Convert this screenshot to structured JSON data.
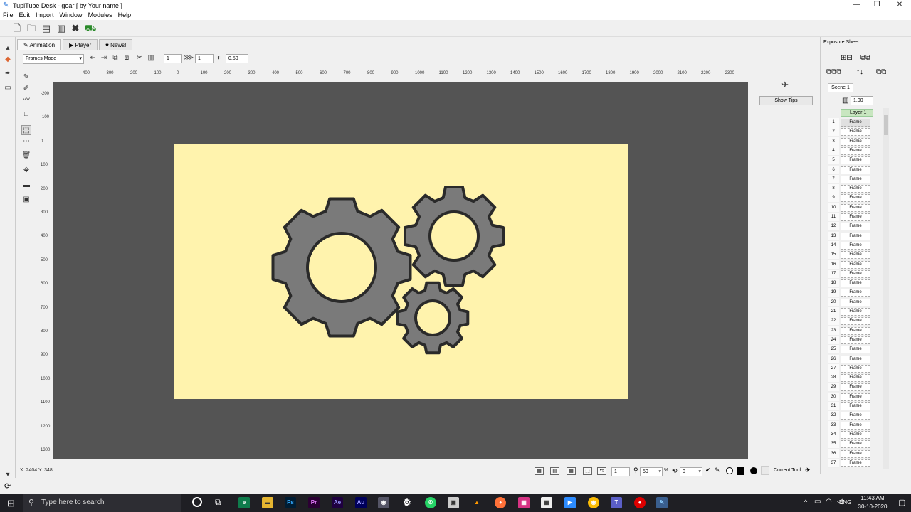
{
  "window": {
    "title": "TupiTube Desk - gear [ by Your name ]",
    "minimize": "—",
    "maximize": "❐",
    "close": "✕"
  },
  "menu": [
    "File",
    "Edit",
    "Import",
    "Window",
    "Modules",
    "Help"
  ],
  "tabs": {
    "animation": "Animation",
    "player": "Player",
    "news": "News!"
  },
  "options": {
    "mode": "Frames Mode",
    "spin1": "1",
    "spin2": "1",
    "opacity": "0.50"
  },
  "ruler": {
    "h_ticks": [
      "-400",
      "-300",
      "-200",
      "-100",
      "0",
      "100",
      "200",
      "300",
      "400",
      "500",
      "600",
      "700",
      "800",
      "900",
      "1000",
      "1100",
      "1200",
      "1300",
      "1400",
      "1500",
      "1600",
      "1700",
      "1800",
      "1900",
      "2000",
      "2100",
      "2200",
      "2300"
    ],
    "v_ticks": [
      "-200",
      "-100",
      "0",
      "100",
      "200",
      "300",
      "400",
      "500",
      "600",
      "700",
      "800",
      "900",
      "1000",
      "1100",
      "1200",
      "1300"
    ]
  },
  "stage": {
    "background": "#fff3ad",
    "gear_fill": "#7a7a7a",
    "gear_stroke": "#2a2a2a"
  },
  "right_panel": {
    "show_tips": "Show Tips"
  },
  "exposure": {
    "title": "Exposure Sheet",
    "scene": "Scene 1",
    "fps": "1.00",
    "layer": "Layer 1",
    "frame_label": "Frame",
    "frame_numbers": [
      "1",
      "2",
      "3",
      "4",
      "5",
      "6",
      "7",
      "8",
      "9",
      "10",
      "11",
      "12",
      "13",
      "14",
      "15",
      "16",
      "17",
      "18",
      "19",
      "20",
      "21",
      "22",
      "23",
      "24",
      "25",
      "26",
      "27",
      "28",
      "29",
      "30",
      "31",
      "32",
      "33",
      "34",
      "35",
      "36",
      "37"
    ]
  },
  "status": {
    "coords": "X: 2404 Y: 348",
    "frame": "1",
    "zoom": "50",
    "zoom_unit": "%",
    "rotation": "0",
    "current_tool": "Current Tool"
  },
  "taskbar": {
    "search_placeholder": "Type here to search",
    "lang": "ENG",
    "time": "11:43 AM",
    "date": "30-10-2020"
  }
}
